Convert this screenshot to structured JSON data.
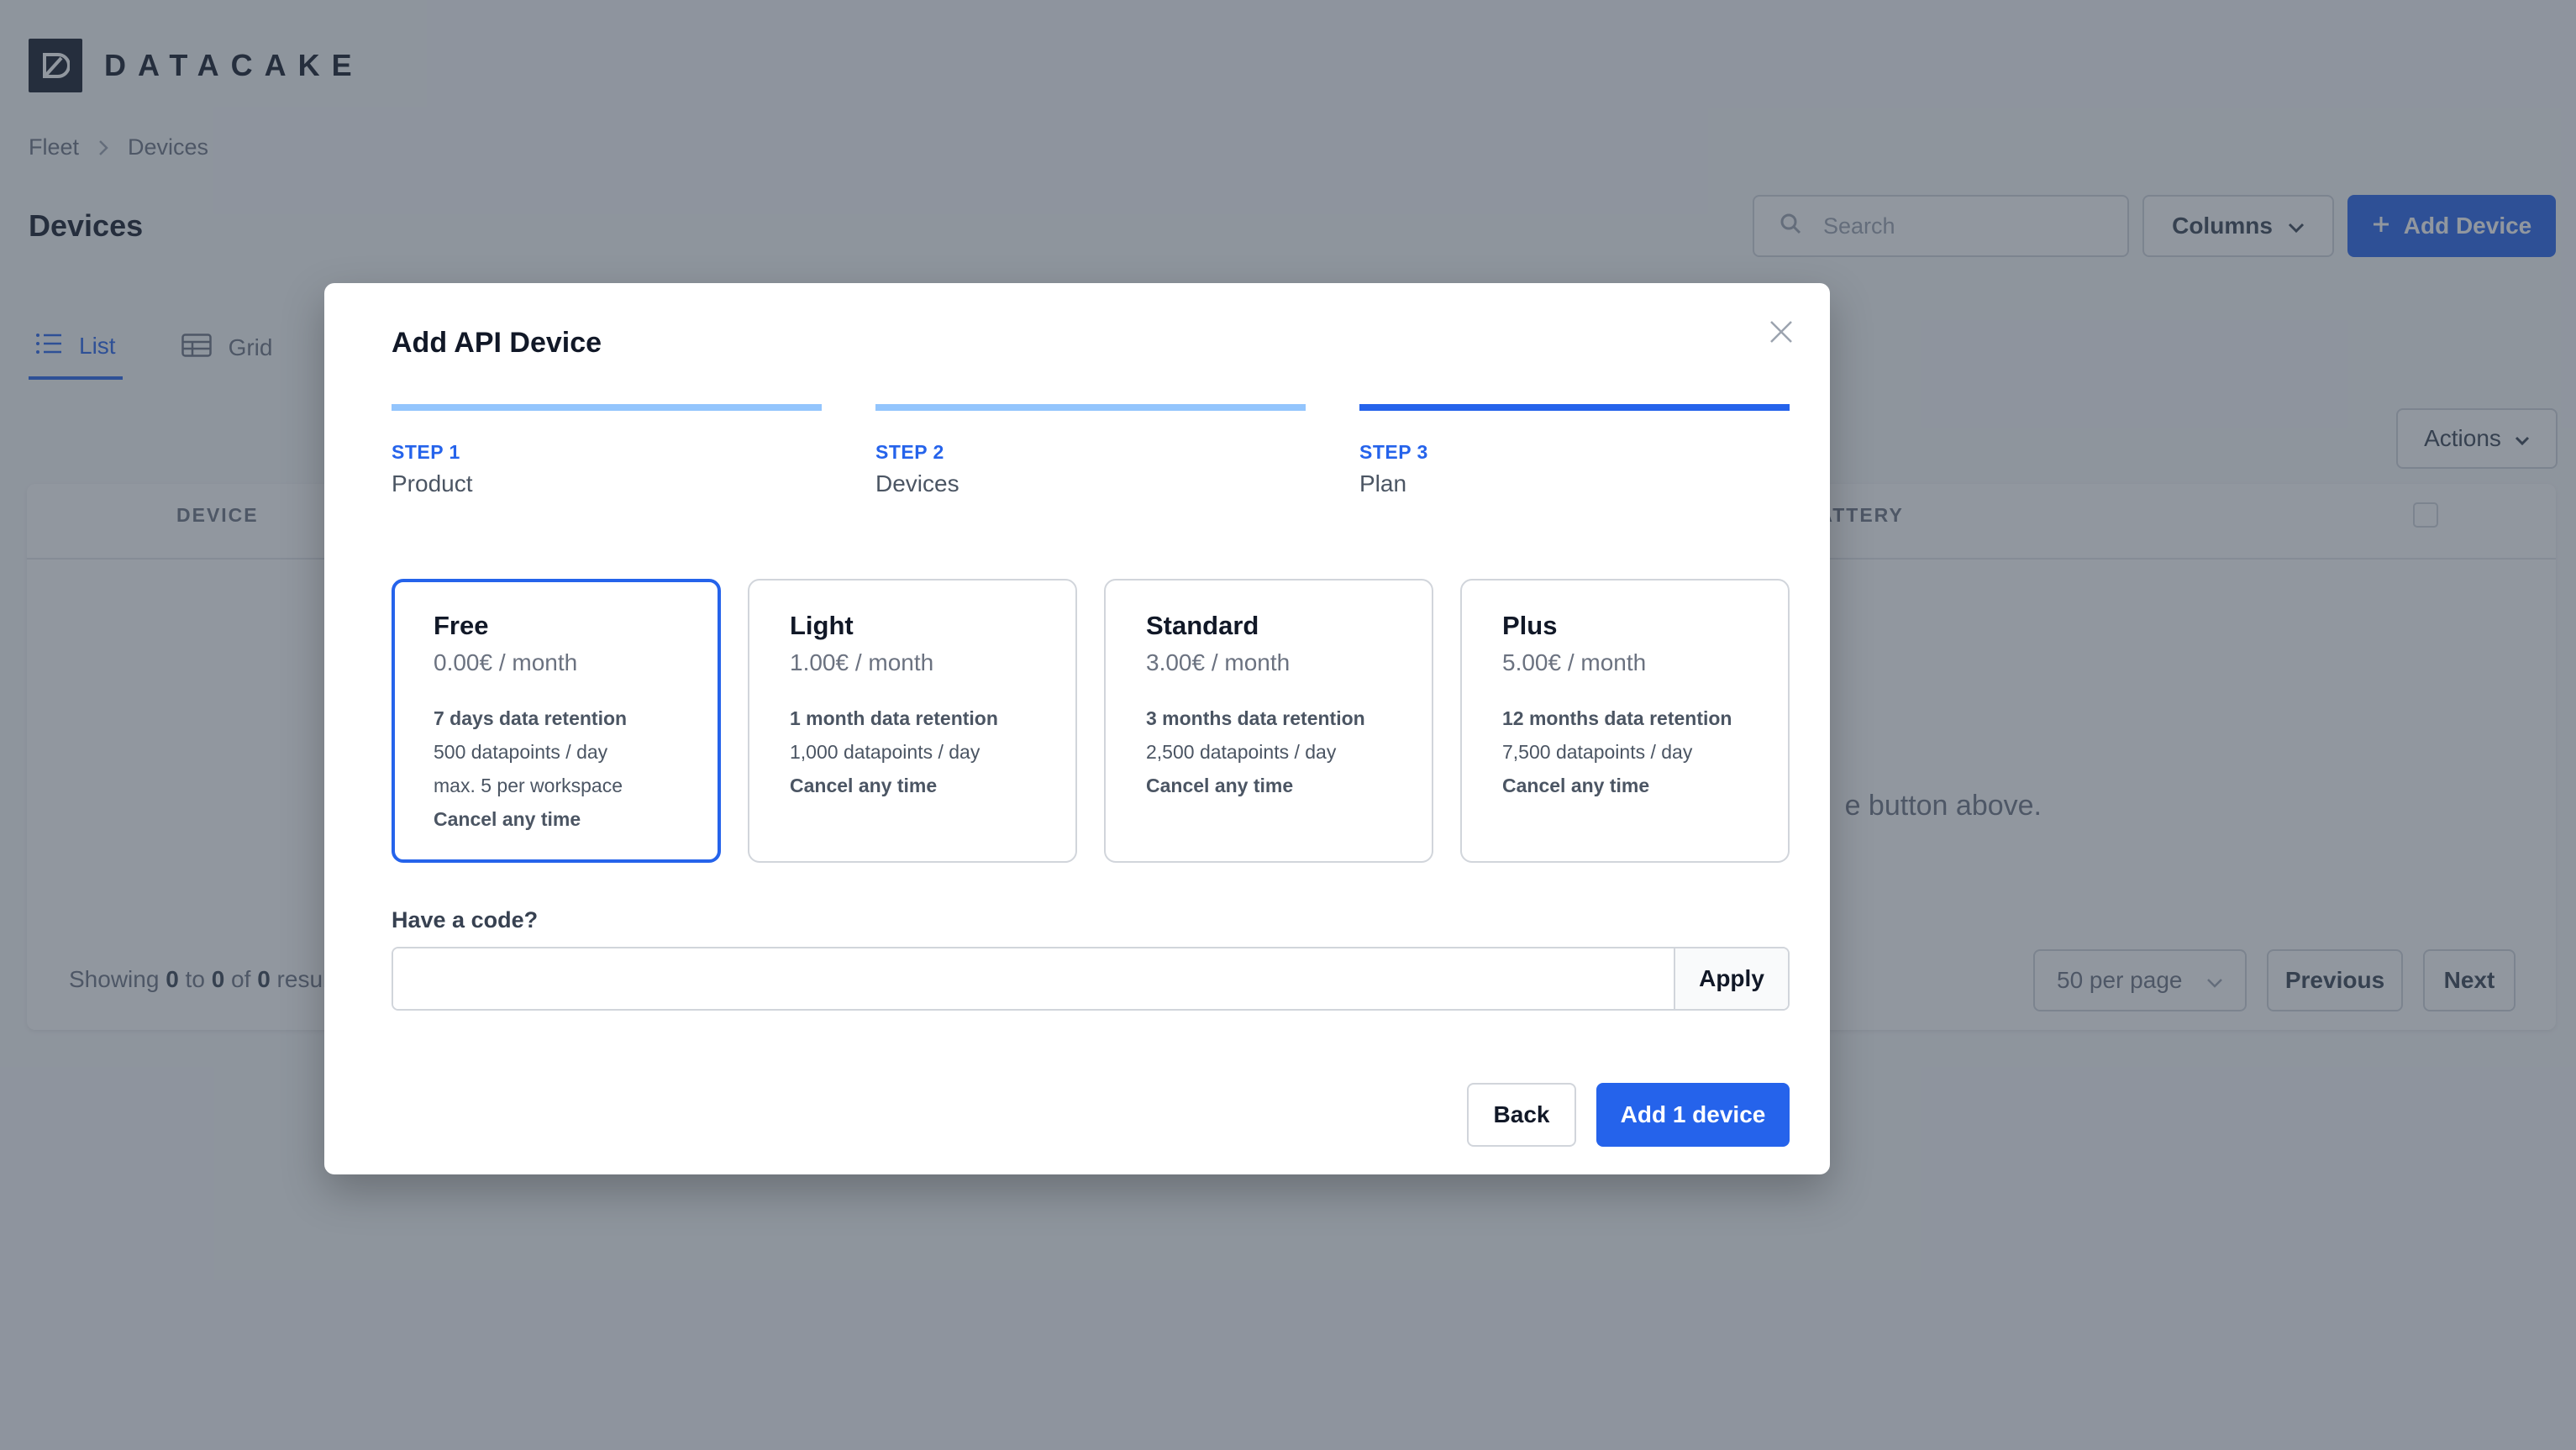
{
  "app": {
    "logo_text": "DATACAKE"
  },
  "breadcrumb": {
    "items": [
      "Fleet",
      "Devices"
    ]
  },
  "page": {
    "title": "Devices"
  },
  "toolbar": {
    "search_placeholder": "Search",
    "columns_label": "Columns",
    "add_device_label": "Add Device",
    "actions_label": "Actions"
  },
  "view_tabs": [
    {
      "label": "List",
      "active": true
    },
    {
      "label": "Grid",
      "active": false
    }
  ],
  "table": {
    "headers": [
      "DEVICE",
      "BATTERY"
    ],
    "header_battery_visible": "E BATTERY",
    "empty_message_visible": "e button above.",
    "showing_prefix": "Showing",
    "showing_from": "0",
    "showing_to_word": "to",
    "showing_to": "0",
    "showing_of_word": "of",
    "showing_total": "0",
    "showing_suffix_visible": "resul"
  },
  "pagination": {
    "per_page": "50 per page",
    "previous_label": "Previous",
    "next_label": "Next"
  },
  "modal": {
    "title": "Add API Device",
    "steps": [
      {
        "number": "STEP 1",
        "name": "Product",
        "state": "complete"
      },
      {
        "number": "STEP 2",
        "name": "Devices",
        "state": "complete"
      },
      {
        "number": "STEP 3",
        "name": "Plan",
        "state": "current"
      }
    ],
    "plans": [
      {
        "name": "Free",
        "price": "0.00€ / month",
        "selected": true,
        "features": [
          "7 days data retention",
          "500 datapoints / day",
          "max. 5 per workspace",
          "Cancel any time"
        ]
      },
      {
        "name": "Light",
        "price": "1.00€ / month",
        "selected": false,
        "features": [
          "1 month data retention",
          "1,000 datapoints / day",
          "Cancel any time"
        ]
      },
      {
        "name": "Standard",
        "price": "3.00€ / month",
        "selected": false,
        "features": [
          "3 months data retention",
          "2,500 datapoints / day",
          "Cancel any time"
        ]
      },
      {
        "name": "Plus",
        "price": "5.00€ / month",
        "selected": false,
        "features": [
          "12 months data retention",
          "7,500 datapoints / day",
          "Cancel any time"
        ]
      }
    ],
    "code_label": "Have a code?",
    "code_value": "",
    "apply_label": "Apply",
    "back_label": "Back",
    "submit_label": "Add 1 device"
  },
  "colors": {
    "accent": "#2563eb",
    "step_complete": "#93c5fd",
    "overlay": "rgba(55,65,81,0.55)"
  }
}
